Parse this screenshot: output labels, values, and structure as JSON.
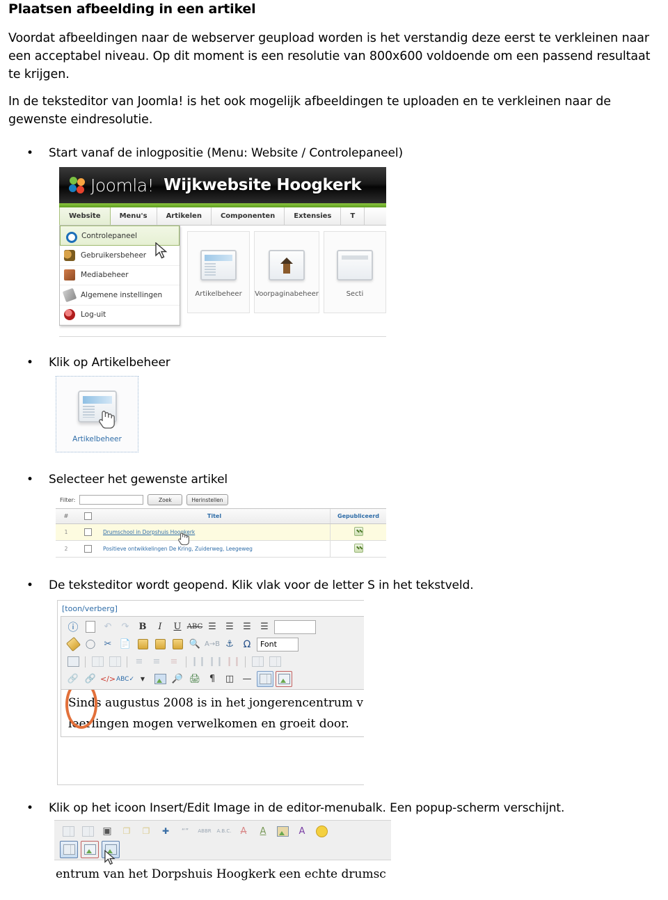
{
  "document": {
    "title": "Plaatsen afbeelding in een artikel",
    "paragraph1": "Voordat afbeeldingen naar de webserver geupload worden is het verstandig deze eerst te verkleinen naar een acceptabel niveau. Op dit moment is een resolutie van 800x600 voldoende om een passend resultaat te krijgen.",
    "paragraph2": "In de teksteditor van Joomla! is het ook mogelijk afbeeldingen te uploaden en te verkleinen naar de gewenste eindresolutie.",
    "bullets": [
      "Start vanaf de inlogpositie (Menu: Website / Controlepaneel)",
      "Klik op Artikelbeheer",
      "Selecteer het gewenste artikel",
      "De teksteditor wordt geopend. Klik vlak voor de letter S in het tekstveld.",
      "Klik op het icoon Insert/Edit Image in de editor-menubalk. Een popup-scherm verschijnt."
    ],
    "bullet_marker": "•"
  },
  "joomla_admin": {
    "logo_text": "Joomla!",
    "site_title": "Wijkwebsite Hoogkerk",
    "menubar": [
      {
        "label": "Website",
        "active": true
      },
      {
        "label": "Menu's",
        "active": false
      },
      {
        "label": "Artikelen",
        "active": false
      },
      {
        "label": "Componenten",
        "active": false
      },
      {
        "label": "Extensies",
        "active": false
      },
      {
        "label": "T",
        "active": false
      }
    ],
    "dropdown": [
      {
        "label": "Controlepaneel",
        "icon": "controlpanel-icon",
        "selected": true
      },
      {
        "label": "Gebruikersbeheer",
        "icon": "users-icon",
        "selected": false
      },
      {
        "label": "Mediabeheer",
        "icon": "media-icon",
        "selected": false
      },
      {
        "label": "Algemene instellingen",
        "icon": "settings-icon",
        "selected": false
      },
      {
        "label": "Log-uit",
        "icon": "logout-icon",
        "selected": false
      }
    ],
    "panel_tiles": [
      {
        "label": "Artikelbeheer"
      },
      {
        "label": "Voorpaginabeheer"
      },
      {
        "label": "Secti"
      }
    ],
    "colors": {
      "header_bg": "#121212",
      "green_bar": "#8dc63f",
      "menu_active_bg": "#e4eed3",
      "link_blue": "#2f6da8"
    }
  },
  "article_tile": {
    "label": "Artikelbeheer",
    "cursor": "hand-cursor"
  },
  "article_list": {
    "filter_label": "Filter:",
    "filter_value": "",
    "filter_placeholder": "",
    "search_button": "Zoek",
    "reset_button": "Herinstellen",
    "columns": [
      "#",
      "",
      "Titel",
      "Gepubliceerd"
    ],
    "rows": [
      {
        "num": "1",
        "title": "Drumschool in Dorpshuis Hoogkerk",
        "published": true,
        "highlighted": true,
        "link": true
      },
      {
        "num": "2",
        "title": "Positieve ontwikkelingen De Kring, Zuiderweg, Leegeweg",
        "published": true,
        "highlighted": false,
        "link": false
      }
    ]
  },
  "editor": {
    "toggle_label": "[toon/verberg]",
    "font_select_value": "Font",
    "toolbar_row1": [
      "help-icon",
      "new-document-icon",
      "undo-icon",
      "redo-icon",
      "bold-icon",
      "italic-icon",
      "underline-icon",
      "strikethrough-icon",
      "align-left-icon",
      "align-center-icon",
      "align-justify-icon",
      "align-right-icon"
    ],
    "toolbar_row2": [
      "cleanup-icon",
      "remove-formatting-icon",
      "cut-icon",
      "copy-icon",
      "paste-icon",
      "paste-word-icon",
      "paste-text-icon",
      "find-icon",
      "find-replace-icon",
      "anchor-icon",
      "special-char-icon"
    ],
    "toolbar_row3": [
      "edit-table-icon",
      "merge-cells-icon",
      "split-cells-icon",
      "insert-row-before-icon",
      "insert-row-after-icon",
      "delete-row-icon",
      "insert-col-before-icon",
      "insert-col-after-icon",
      "delete-col-icon",
      "table-row-props-icon",
      "table-cell-props-icon"
    ],
    "toolbar_row4": [
      "unlink-icon",
      "link-icon",
      "source-code-icon",
      "spellcheck-icon",
      "spellcheck-dropdown-icon",
      "readmore-icon",
      "preview-icon",
      "print-icon",
      "paragraph-icon",
      "pagebreak-icon",
      "horizontal-rule-icon",
      "insert-table-icon",
      "insert-pagebreak-icon"
    ],
    "content_line1": "Sinds augustus 2008 is in het jongerencentrum v",
    "content_line2": "leerlingen mogen verwelkomen en groeit door.",
    "annotation": "orange-ellipse-highlight",
    "annotation_color": "#e2703a"
  },
  "bottom_toolbar": {
    "row1": [
      "table-icon",
      "table-split-icon",
      "select-region-icon",
      "layer-back-icon",
      "layer-forward-icon",
      "add-layer-icon",
      "blockquote-icon",
      "abbr-icon",
      "acronym-icon",
      "del-icon",
      "ins-icon",
      "attributes-icon",
      "style-icon",
      "emoticon-icon"
    ],
    "row2": [
      "insert-table-icon",
      "insert-pagebreak-icon",
      "insert-edit-image-icon"
    ],
    "highlighted_button": "insert-edit-image-icon",
    "content_text": "entrum van het Dorpshuis Hoogkerk een echte drumsc",
    "cursor": "arrow-cursor"
  }
}
